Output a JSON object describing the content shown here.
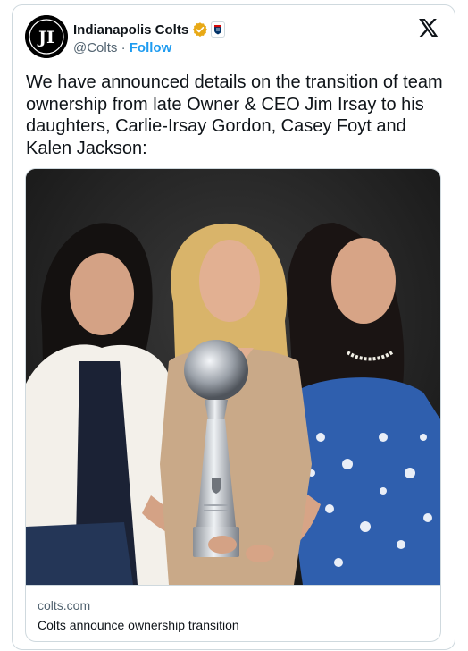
{
  "tweet": {
    "author": {
      "display_name": "Indianapolis Colts",
      "handle": "@Colts",
      "separator": " · ",
      "follow_label": "Follow",
      "verified_badge_color": "#e8a916",
      "avatar_text": "JI"
    },
    "text": "We have announced details on the transition of team ownership from late Owner & CEO Jim Irsay to his daughters, Carlie-Irsay Gordon, Casey Foyt and Kalen Jackson:",
    "card": {
      "image_icon": "photo",
      "domain": "colts.com",
      "title": "Colts announce ownership transition"
    },
    "platform_icon": "x-logo-icon"
  },
  "colors": {
    "link": "#1d9bf0",
    "text_primary": "#0f1419",
    "text_secondary": "#536471",
    "border": "#cfd9de"
  }
}
